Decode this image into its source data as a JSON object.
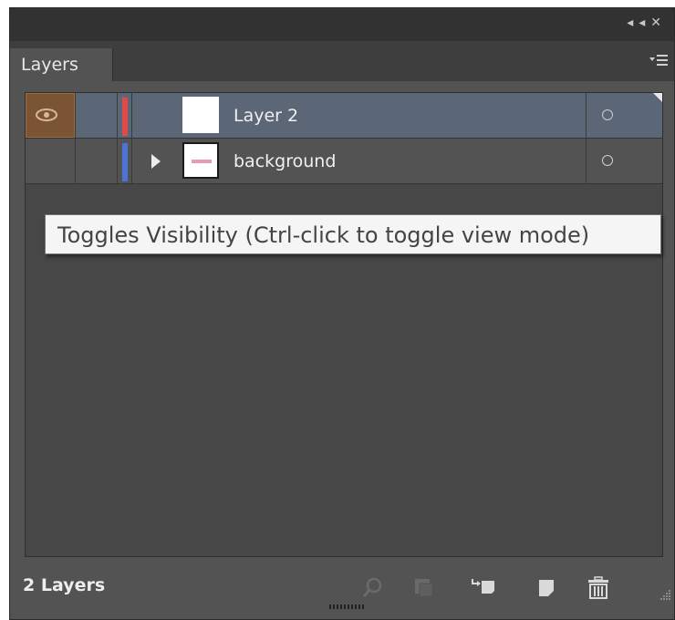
{
  "panel": {
    "tab_label": "Layers",
    "collapse_icon": "double-left-arrow-icon",
    "close_icon": "close-icon",
    "menu_icon": "panel-menu-icon"
  },
  "layers": [
    {
      "name": "Layer 2",
      "color": "#e04a4a",
      "selected": true,
      "visible_toggle_hover": true,
      "expandable": false
    },
    {
      "name": "background",
      "color": "#4f72d8",
      "selected": false,
      "visible_toggle_hover": false,
      "expandable": true
    }
  ],
  "tooltip": {
    "text": "Toggles Visibility (Ctrl-click to toggle view mode)"
  },
  "footer": {
    "count_label": "2 Layers",
    "buttons": [
      "locate-object-icon",
      "make-clipping-mask-icon",
      "create-sublayer-icon",
      "create-new-layer-icon",
      "delete-layer-icon"
    ]
  },
  "colors": {
    "panel_bg": "#535353",
    "selected_row": "#5b6676",
    "eye_highlight": "#7a5433"
  }
}
